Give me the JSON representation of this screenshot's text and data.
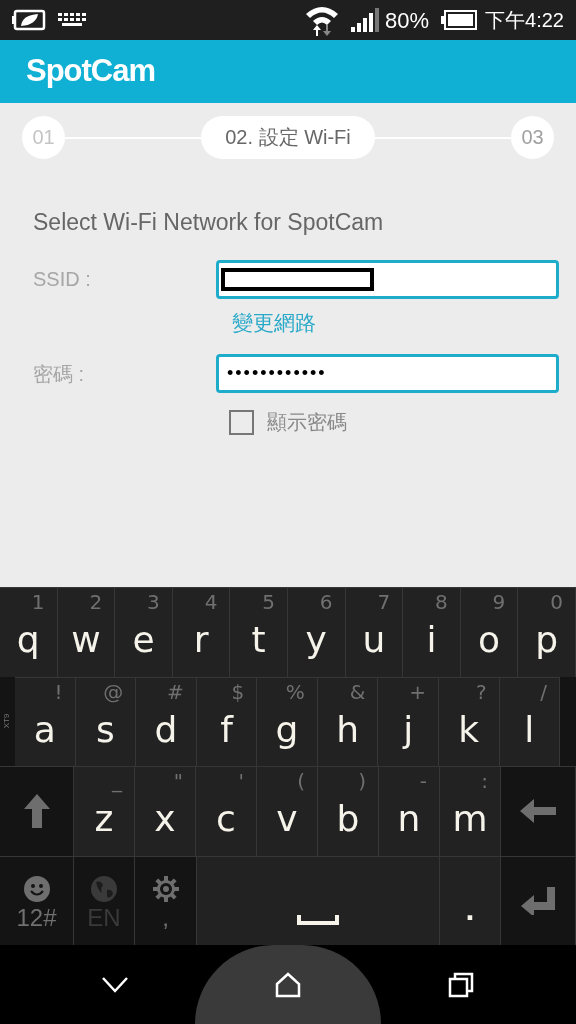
{
  "status_bar": {
    "battery_percent": "80%",
    "time": "下午4:22"
  },
  "header": {
    "logo": "SpotCam"
  },
  "steps": [
    {
      "label": "01",
      "selected": false
    },
    {
      "label": "02. 設定 Wi-Fi",
      "selected": true
    },
    {
      "label": "03",
      "selected": false
    }
  ],
  "form": {
    "title": "Select Wi-Fi Network for SpotCam",
    "ssid": {
      "label": "SSID :"
    },
    "change_network_link": "變更網路",
    "password": {
      "label": "密碼 :",
      "value": "••••••••••••"
    },
    "show_password": {
      "label": "顯示密碼",
      "checked": false
    }
  },
  "keyboard": {
    "side_label": "XT9",
    "rows": [
      {
        "keys": [
          {
            "kind": "key",
            "label": "q",
            "hint": "1"
          },
          {
            "kind": "key",
            "label": "w",
            "hint": "2"
          },
          {
            "kind": "key",
            "label": "e",
            "hint": "3"
          },
          {
            "kind": "key",
            "label": "r",
            "hint": "4"
          },
          {
            "kind": "key",
            "label": "t",
            "hint": "5"
          },
          {
            "kind": "key",
            "label": "y",
            "hint": "6"
          },
          {
            "kind": "key",
            "label": "u",
            "hint": "7"
          },
          {
            "kind": "key",
            "label": "i",
            "hint": "8"
          },
          {
            "kind": "key",
            "label": "o",
            "hint": "9"
          },
          {
            "kind": "key",
            "label": "p",
            "hint": "0"
          }
        ]
      },
      {
        "keys": [
          {
            "kind": "key",
            "label": "a",
            "hint": "!"
          },
          {
            "kind": "key",
            "label": "s",
            "hint": "@"
          },
          {
            "kind": "key",
            "label": "d",
            "hint": "#"
          },
          {
            "kind": "key",
            "label": "f",
            "hint": "$"
          },
          {
            "kind": "key",
            "label": "g",
            "hint": "%"
          },
          {
            "kind": "key",
            "label": "h",
            "hint": "&"
          },
          {
            "kind": "key",
            "label": "j",
            "hint": "+"
          },
          {
            "kind": "key",
            "label": "k",
            "hint": "?"
          },
          {
            "kind": "key",
            "label": "l",
            "hint": "/"
          }
        ]
      },
      {
        "keys": [
          {
            "kind": "shift"
          },
          {
            "kind": "key",
            "label": "z",
            "hint": "_"
          },
          {
            "kind": "key",
            "label": "x",
            "hint": "\""
          },
          {
            "kind": "key",
            "label": "c",
            "hint": "'"
          },
          {
            "kind": "key",
            "label": "v",
            "hint": "("
          },
          {
            "kind": "key",
            "label": "b",
            "hint": ")"
          },
          {
            "kind": "key",
            "label": "n",
            "hint": "-"
          },
          {
            "kind": "key",
            "label": "m",
            "hint": ":"
          },
          {
            "kind": "backspace"
          }
        ]
      },
      {
        "keys": [
          {
            "kind": "emoji",
            "label": "12#"
          },
          {
            "kind": "globe",
            "label": "EN"
          },
          {
            "kind": "gear",
            "label": ","
          },
          {
            "kind": "space"
          },
          {
            "kind": "plain",
            "label": "."
          },
          {
            "kind": "enter"
          }
        ]
      }
    ]
  }
}
